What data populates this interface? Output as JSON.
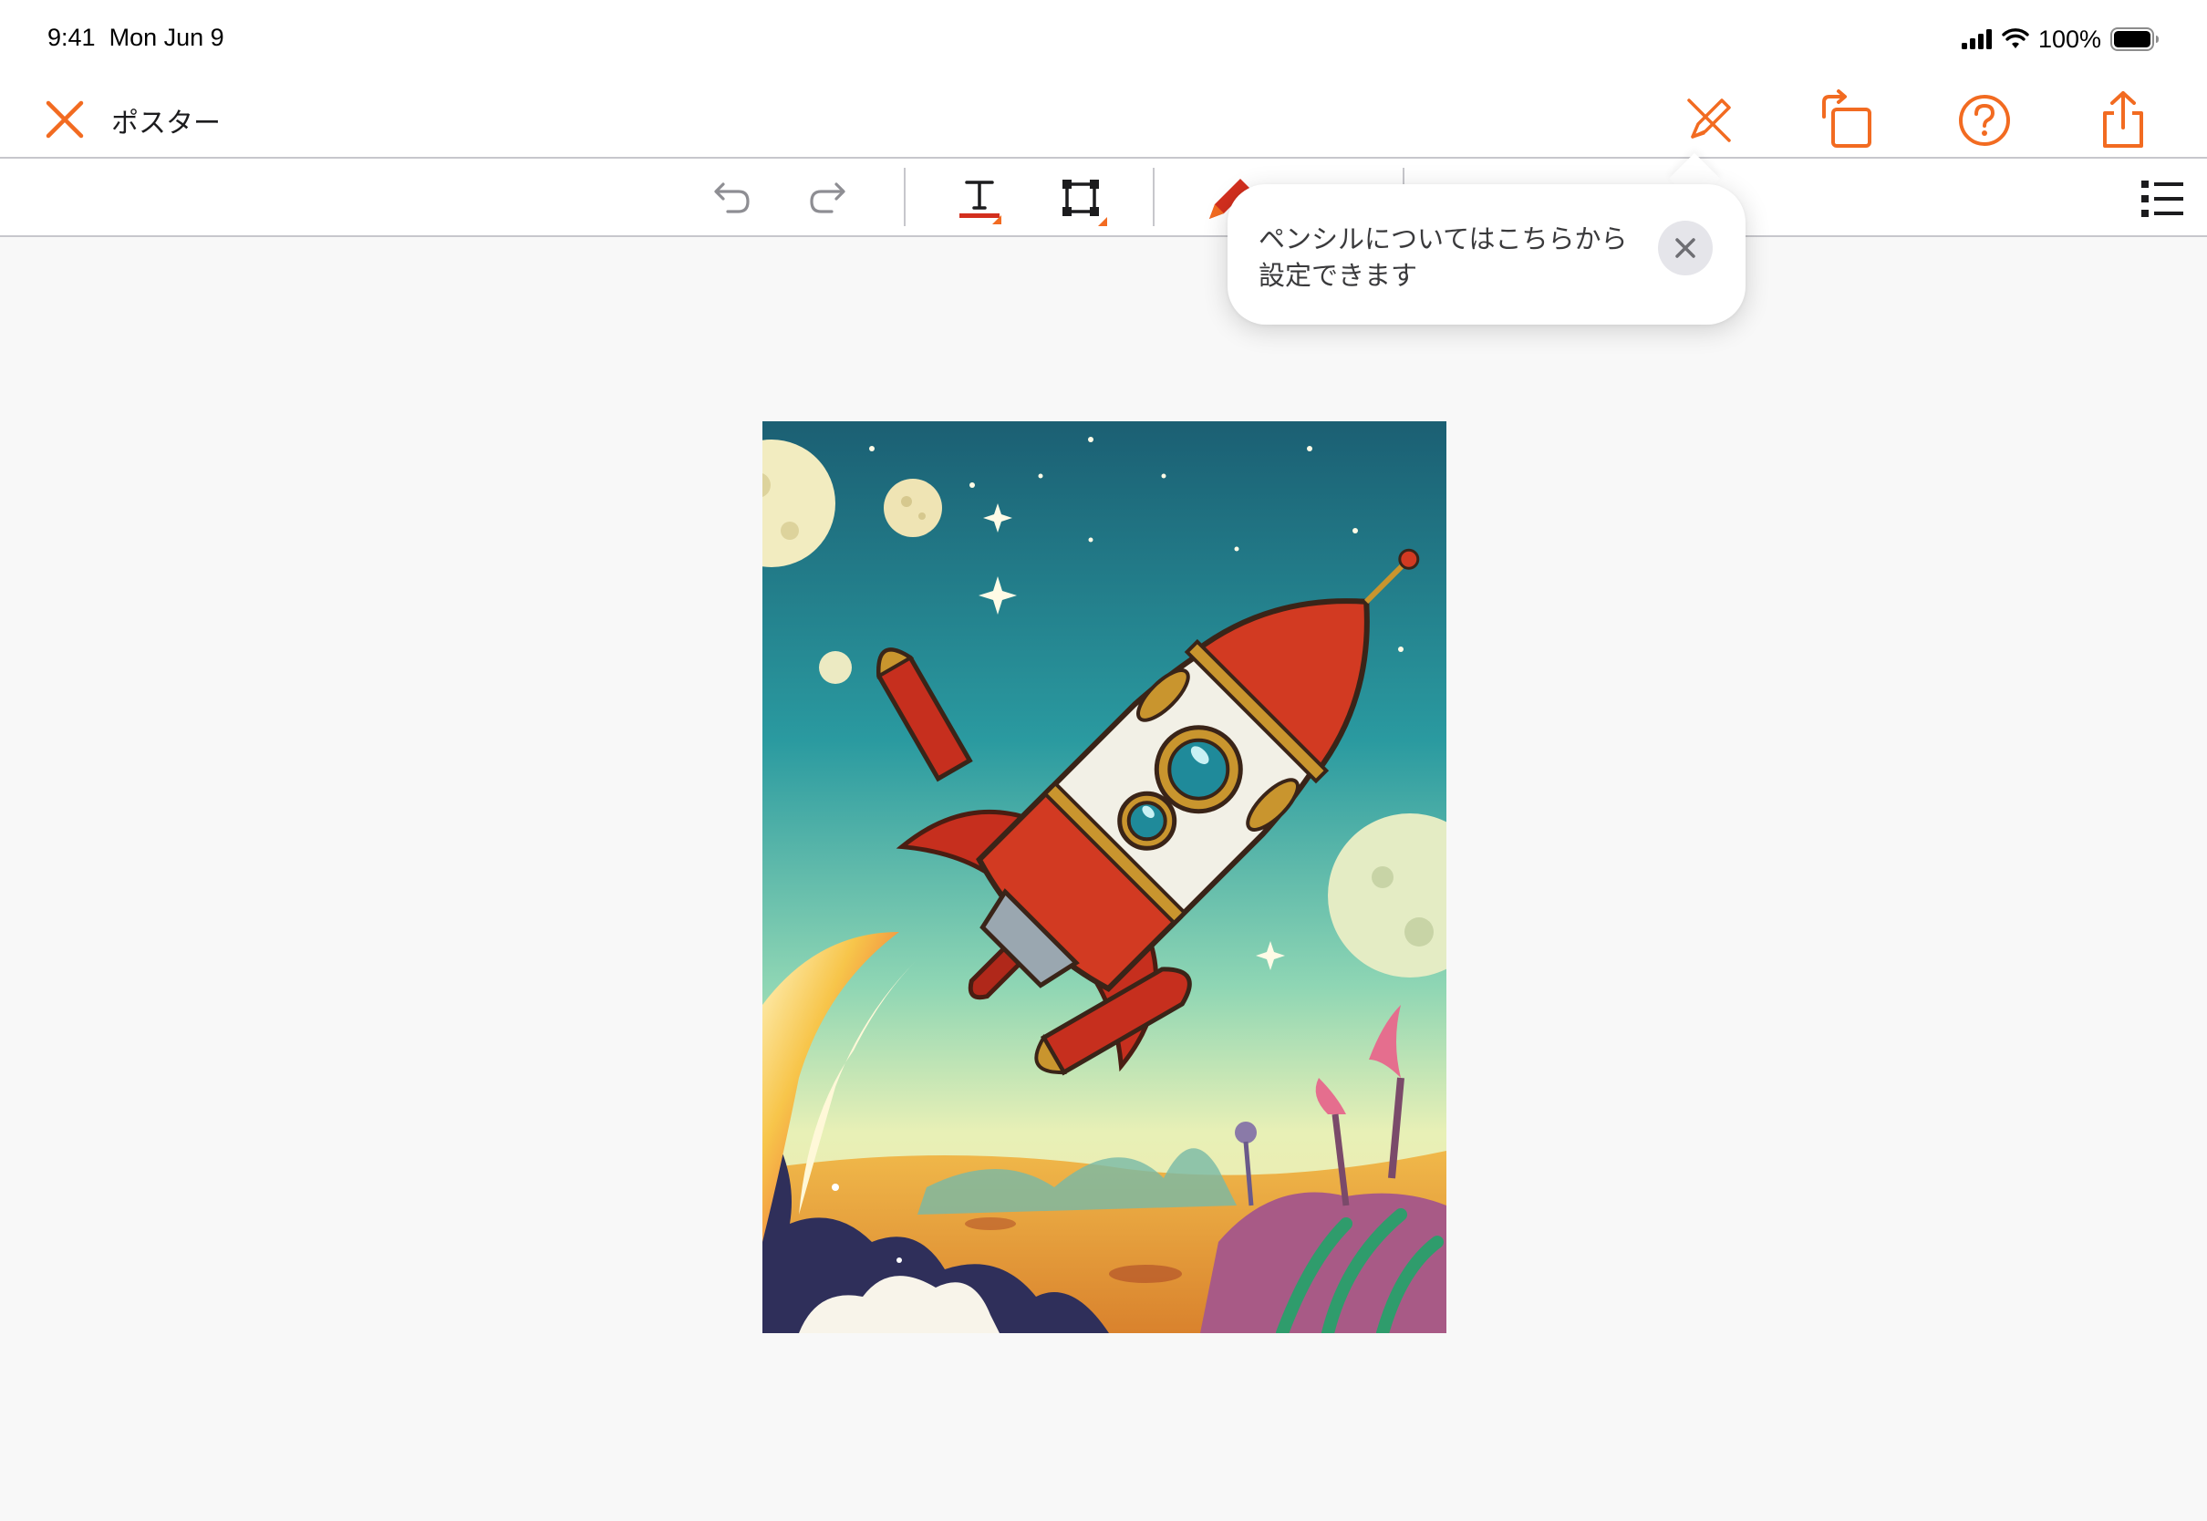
{
  "status_bar": {
    "time": "9:41",
    "date": "Mon Jun 9",
    "battery_percent": "100%"
  },
  "nav": {
    "title": "ポスター",
    "accent_color": "#f26b21",
    "buttons": [
      "close-icon",
      "pencil-off-icon",
      "rotate-icon",
      "help-icon",
      "share-icon"
    ]
  },
  "toolbar": {
    "tools": [
      "undo-icon",
      "redo-icon",
      "text-tool-icon",
      "shape-tool-icon",
      "pen-tool-icon",
      "list-icon"
    ]
  },
  "tooltip": {
    "message": "ペンシルについてはこちらから設定できます",
    "line1": "ペンシルについてはこちらから",
    "line2": "設定できます"
  },
  "canvas": {
    "artwork": "rocket-illustration"
  }
}
